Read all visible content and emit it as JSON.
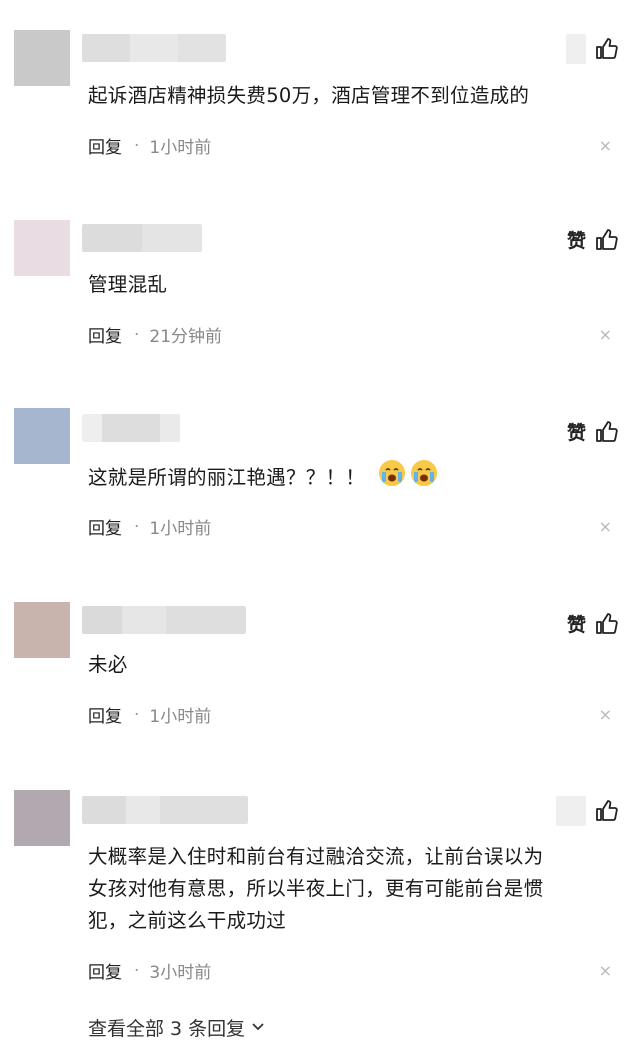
{
  "comments": [
    {
      "text": "起诉酒店精神损失费50万，酒店管理不到位造成的",
      "reply_label": "回复",
      "dot": "·",
      "time": "1小时前",
      "like_label": "",
      "close": "×"
    },
    {
      "text": "管理混乱",
      "reply_label": "回复",
      "dot": "·",
      "time": "21分钟前",
      "like_label": "赞",
      "close": "×"
    },
    {
      "text": "这就是所谓的丽江艳遇？？！！",
      "reply_label": "回复",
      "dot": "·",
      "time": "1小时前",
      "like_label": "赞",
      "close": "×",
      "emojis": [
        "crying-face-emoji",
        "crying-face-emoji"
      ]
    },
    {
      "text": "未必",
      "reply_label": "回复",
      "dot": "·",
      "time": "1小时前",
      "like_label": "赞",
      "close": "×"
    },
    {
      "text_lines": [
        "大概率是入住时和前台有过融洽交流，让前台误以为",
        "女孩对他有意思，所以半夜上门，更有可能前台是惯",
        "犯，之前这么干成功过"
      ],
      "reply_label": "回复",
      "dot": "·",
      "time": "3小时前",
      "like_label": "",
      "close": "×"
    }
  ],
  "view_all": {
    "label": "查看全部 3 条回复"
  },
  "icons": [
    "thumbs-up-icon",
    "close-icon",
    "chevron-down-icon",
    "crying-face-emoji"
  ],
  "colors": {
    "text": "#1a1a1a",
    "meta": "#888888",
    "close": "#b8b8b8"
  }
}
